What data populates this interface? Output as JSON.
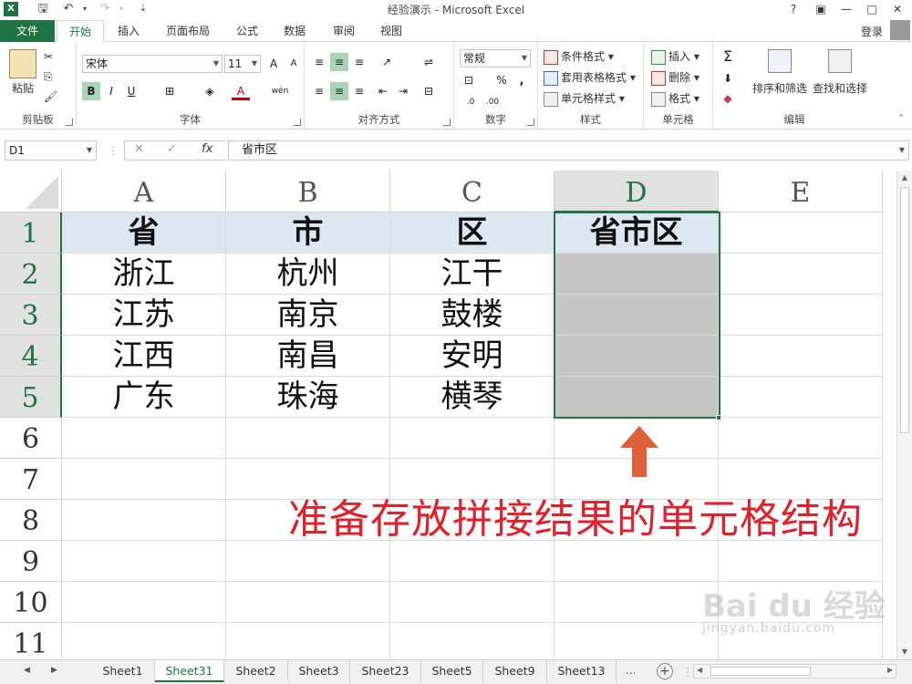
{
  "window": {
    "title": "经验演示 - Microsoft Excel",
    "app_icon": "X",
    "controls": [
      "?",
      "▣",
      "—",
      "□",
      "✕"
    ]
  },
  "tabs": {
    "file": "文件",
    "items": [
      "开始",
      "插入",
      "页面布局",
      "公式",
      "数据",
      "审阅",
      "视图"
    ],
    "active": "开始",
    "login": "登录"
  },
  "ribbon": {
    "clipboard": {
      "label": "剪贴板",
      "paste": "粘贴"
    },
    "font": {
      "label": "字体",
      "font_name": "宋体",
      "font_size": "11",
      "bold": "B",
      "italic": "I",
      "underline": "U",
      "grow": "A",
      "shrink": "A",
      "color_a": "A",
      "wen": "wén"
    },
    "alignment": {
      "label": "对齐方式"
    },
    "number": {
      "label": "数字",
      "format": "常规",
      "percent": "%",
      "comma": ","
    },
    "styles": {
      "label": "样式",
      "conditional": "条件格式",
      "table": "套用表格格式",
      "cell_styles": "单元格样式"
    },
    "cells": {
      "label": "单元格",
      "insert": "插入",
      "delete": "删除",
      "format": "格式"
    },
    "editing": {
      "label": "编辑",
      "sort": "排序和筛选",
      "find": "查找和选择",
      "sigma": "Σ"
    }
  },
  "formula_bar": {
    "name_box": "D1",
    "cancel": "✕",
    "enter": "✓",
    "fx": "fx",
    "content": "省市区"
  },
  "grid": {
    "columns": [
      "A",
      "B",
      "C",
      "D",
      "E"
    ],
    "rows": [
      "1",
      "2",
      "3",
      "4",
      "5",
      "6",
      "7",
      "8",
      "9",
      "10",
      "11"
    ],
    "header": [
      "省",
      "市",
      "区",
      "省市区"
    ],
    "data": [
      [
        "浙江",
        "杭州",
        "江干"
      ],
      [
        "江苏",
        "南京",
        "鼓楼"
      ],
      [
        "江西",
        "南昌",
        "安明"
      ],
      [
        "广东",
        "珠海",
        "横琴"
      ]
    ],
    "selected_range": "D1:D5"
  },
  "annotation": "准备存放拼接结果的单元格结构",
  "watermark": {
    "logo": "Bai du 经验",
    "url": "jingyan.baidu.com"
  },
  "sheets": {
    "items": [
      "Sheet1",
      "Sheet31",
      "Sheet2",
      "Sheet3",
      "Sheet23",
      "Sheet5",
      "Sheet9",
      "Sheet13"
    ],
    "active": "Sheet31",
    "more": "...",
    "add": "+"
  },
  "colors": {
    "accent": "#217346",
    "annotation": "#e0202a",
    "header_fill": "#dde7f1",
    "selection_fill": "#c6c6c6"
  }
}
